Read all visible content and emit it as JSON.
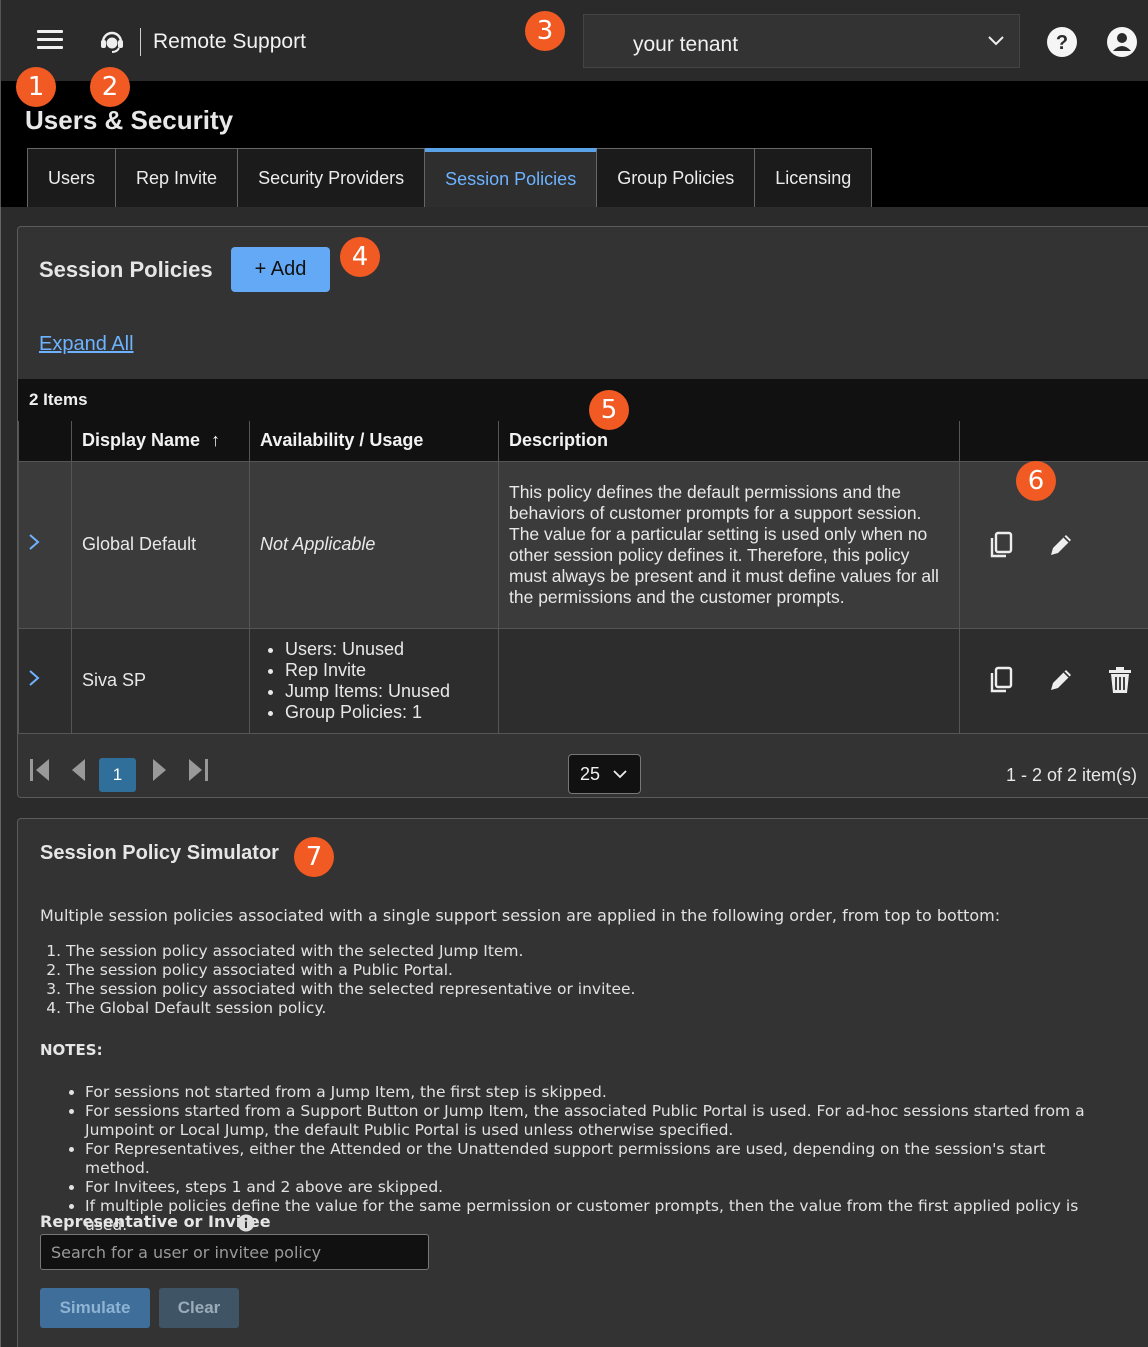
{
  "header": {
    "app_title": "Remote Support",
    "tenant": "your tenant",
    "icons": [
      "menu-icon",
      "headset-logo-icon",
      "chevron-down-icon",
      "help-icon",
      "user-account-icon"
    ]
  },
  "badges": [
    "1",
    "2",
    "3",
    "4",
    "5",
    "6",
    "7"
  ],
  "page": {
    "title": "Users & Security",
    "tabs": [
      "Users",
      "Rep Invite",
      "Security Providers",
      "Session Policies",
      "Group Policies",
      "Licensing"
    ],
    "active_tab": "Session Policies"
  },
  "session_policies": {
    "title": "Session Policies",
    "add_label": "+ Add",
    "expand_all": "Expand All",
    "item_count": "2 Items",
    "columns": [
      "Display Name",
      "Availability / Usage",
      "Description"
    ],
    "sort_indicator": "↑",
    "rows": [
      {
        "name": "Global Default",
        "availability": "Not Applicable",
        "description": "This policy defines the default permissions and the behaviors of customer prompts for a support session. The value for a particular setting is used only when no other session policy defines it. Therefore, this policy must always be present and it must define values for all the permissions and the customer prompts."
      },
      {
        "name": "Siva SP",
        "usage": [
          "Users: Unused",
          "Rep Invite",
          "Jump Items: Unused",
          "Group Policies: 1"
        ],
        "description": ""
      }
    ],
    "pager": {
      "current_page": "1",
      "page_size": "25",
      "info": "1 - 2 of 2 item(s)"
    }
  },
  "simulator": {
    "title": "Session Policy Simulator",
    "intro": "Multiple session policies associated with a single support session are applied in the following order, from top to bottom:",
    "steps": [
      "The session policy associated with the selected Jump Item.",
      "The session policy associated with a Public Portal.",
      "The session policy associated with the selected representative or invitee.",
      "The Global Default session policy."
    ],
    "notes_label": "NOTES:",
    "notes": [
      "For sessions not started from a Jump Item, the first step is skipped.",
      "For sessions started from a Support Button or Jump Item, the associated Public Portal is used. For ad-hoc sessions started from a Jumpoint or Local Jump, the default Public Portal is used unless otherwise specified.",
      "For Representatives, either the Attended or the Unattended support permissions are used, depending on the session's start method.",
      "For Invitees, steps 1 and 2 above are skipped.",
      "If multiple policies define the value for the same permission or customer prompts, then the value from the first applied policy is used."
    ],
    "rep_label": "Representative or Invitee",
    "search_placeholder": "Search for a user or invitee policy",
    "simulate_label": "Simulate",
    "clear_label": "Clear"
  },
  "colors": {
    "accent": "#5aa2e8",
    "badge": "#f15a22",
    "add_button": "#63a9f5"
  }
}
